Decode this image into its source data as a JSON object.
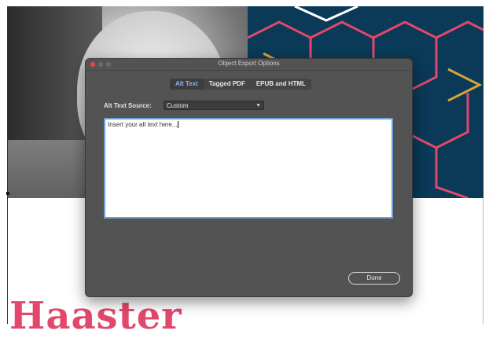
{
  "background": {
    "headline": "Haaster",
    "colors": {
      "pattern_bg": "#0a3a57",
      "pattern_pink": "#e2486b",
      "pattern_white": "#ffffff",
      "pattern_gold": "#d8a23a",
      "headline": "#e2486b"
    }
  },
  "dialog": {
    "title": "Object Export Options",
    "window_controls": [
      "close-icon",
      "minimize-icon",
      "maximize-icon"
    ],
    "tabs": [
      {
        "label": "Alt Text",
        "active": true
      },
      {
        "label": "Tagged PDF",
        "active": false
      },
      {
        "label": "EPUB and HTML",
        "active": false
      }
    ],
    "alt_text_source": {
      "label": "Alt Text Source:",
      "value": "Custom"
    },
    "alt_text": {
      "value": "Insert your alt text here..."
    },
    "done_label": "Done",
    "colors": {
      "dialog_bg": "#535353",
      "active_tab_text": "#8ab4ea",
      "textarea_focus": "#6d9fd8"
    }
  }
}
